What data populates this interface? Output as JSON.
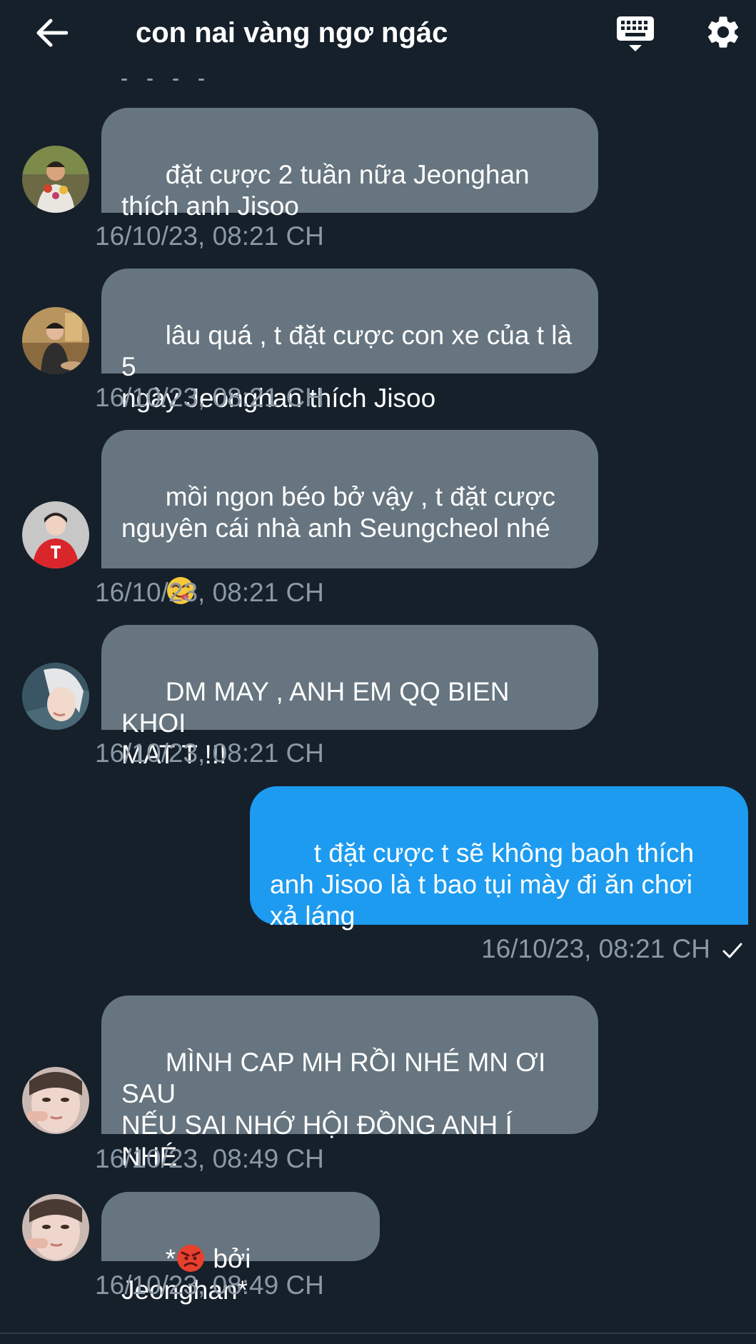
{
  "header": {
    "title": "con nai vàng ngơ ngác"
  },
  "icons": {
    "back": "arrow-left-icon",
    "keyboard": "keyboard-icon",
    "settings": "gear-icon"
  },
  "colors": {
    "background": "#15202b",
    "incoming_bubble": "#66757f",
    "outgoing_bubble": "#1d9bf0",
    "timestamp": "#8b98a5"
  },
  "messages": [
    {
      "direction": "incoming",
      "text": "đặt cược 2 tuần nữa Jeonghan\nthích anh Jisoo",
      "time": "16/10/23, 08:21 CH"
    },
    {
      "direction": "incoming",
      "text": "lâu quá , t đặt cược con xe của t là 5\nngày Jeonghan thích Jisoo",
      "time": "16/10/23, 08:21 CH"
    },
    {
      "direction": "incoming",
      "text": "mồi ngon béo bở vậy , t đặt cược\nnguyên cái nhà anh Seungcheol nhé",
      "emoji": "yum-face-emoji",
      "time": "16/10/23, 08:21 CH"
    },
    {
      "direction": "incoming",
      "text": "DM MAY , ANH EM QQ BIEN KHOI\nMAT T !!!",
      "time": "16/10/23, 08:21 CH"
    },
    {
      "direction": "outgoing",
      "text": "t đặt cược t sẽ không baoh thích\nanh Jisoo là t bao tụi mày đi ăn chơi\nxả láng",
      "time": "16/10/23, 08:21 CH",
      "status_icon": "check-icon"
    },
    {
      "direction": "incoming",
      "text": "MÌNH CAP MH RỒI NHÉ MN ƠI SAU\nNẾU SAI NHỚ HỘI ĐỒNG ANH Í\nNHÉ",
      "time": "16/10/23, 08:49 CH"
    },
    {
      "direction": "incoming",
      "text_before_emoji": "*",
      "emoji": "angry-face-emoji",
      "text": " bởi Jeonghan*",
      "time": "16/10/23, 08:49 CH"
    }
  ]
}
